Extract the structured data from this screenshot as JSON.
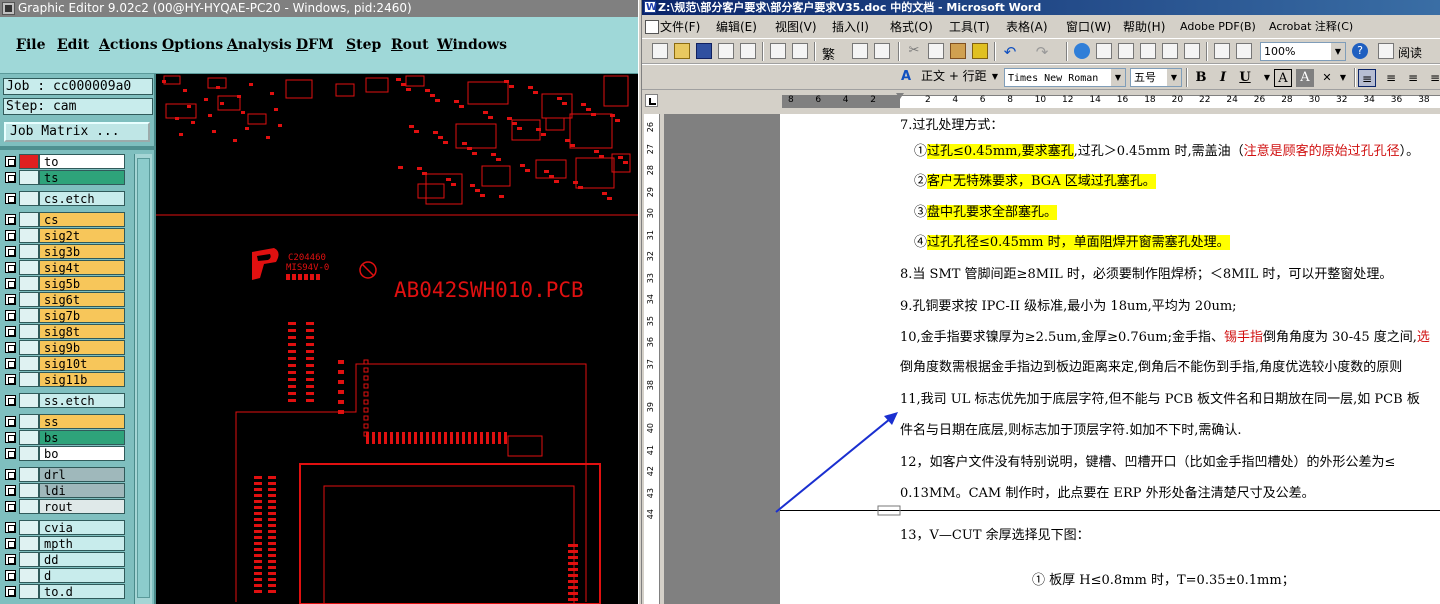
{
  "ge": {
    "title": "Graphic Editor 9.02c2 (00@HY-HYQAE-PC20 - Windows, pid:2460)",
    "menu": [
      "File",
      "Edit",
      "Actions",
      "Options",
      "Analysis",
      "DFM",
      "Step",
      "Rout",
      "Windows"
    ],
    "job": "Job : cc000009a0",
    "step": "Step: cam",
    "job_matrix": "Job Matrix ...",
    "layers": [
      {
        "name": "to",
        "color": "#ffffff",
        "gap": false
      },
      {
        "name": "ts",
        "color": "#2ea37a",
        "gap": false
      },
      {
        "name": "cs.etch",
        "color": "#c8ecec",
        "gap": true
      },
      {
        "name": "cs",
        "color": "#f7c65a",
        "gap": true
      },
      {
        "name": "sig2t",
        "color": "#f7c65a",
        "gap": false
      },
      {
        "name": "sig3b",
        "color": "#f7c65a",
        "gap": false
      },
      {
        "name": "sig4t",
        "color": "#f7c65a",
        "gap": false
      },
      {
        "name": "sig5b",
        "color": "#f7c65a",
        "gap": false
      },
      {
        "name": "sig6t",
        "color": "#f7c65a",
        "gap": false
      },
      {
        "name": "sig7b",
        "color": "#f7c65a",
        "gap": false
      },
      {
        "name": "sig8t",
        "color": "#f7c65a",
        "gap": false
      },
      {
        "name": "sig9b",
        "color": "#f7c65a",
        "gap": false
      },
      {
        "name": "sig10t",
        "color": "#f7c65a",
        "gap": false
      },
      {
        "name": "sig11b",
        "color": "#f7c65a",
        "gap": false
      },
      {
        "name": "ss.etch",
        "color": "#c8ecec",
        "gap": true
      },
      {
        "name": "ss",
        "color": "#f7c65a",
        "gap": true
      },
      {
        "name": "bs",
        "color": "#2ea37a",
        "gap": false
      },
      {
        "name": "bo",
        "color": "#ffffff",
        "gap": false
      },
      {
        "name": "drl",
        "color": "#9fb8bb",
        "gap": true
      },
      {
        "name": "ldi",
        "color": "#9fb8bb",
        "gap": false
      },
      {
        "name": "rout",
        "color": "#dfe9e9",
        "gap": false
      },
      {
        "name": "cvia",
        "color": "#c8ecec",
        "gap": true
      },
      {
        "name": "mpth",
        "color": "#c8ecec",
        "gap": false
      },
      {
        "name": "dd",
        "color": "#c8ecec",
        "gap": false
      },
      {
        "name": "d",
        "color": "#c8ecec",
        "gap": false
      },
      {
        "name": "to.d",
        "color": "#c8ecec",
        "gap": false
      }
    ],
    "pcb_label": "AB042SWH010.PCB",
    "pcb_small_1": "C204460",
    "pcb_small_2": "MIS94V-0",
    "pcb_color": "#e01010"
  },
  "wd": {
    "title": "Z:\\规范\\部分客户要求\\部分客户要求V35.doc 中的文档 - Microsoft Word",
    "menu": [
      "文件(F)",
      "编辑(E)",
      "视图(V)",
      "插入(I)",
      "格式(O)",
      "工具(T)",
      "表格(A)",
      "窗口(W)",
      "帮助(H)",
      "Adobe PDF(B)",
      "Acrobat 注释(C)"
    ],
    "zoom": "100%",
    "read_label": "阅读",
    "style": "正文 + 行距",
    "font": "Times New Roman",
    "size": "五号",
    "ruler_ticks": [
      "8",
      "6",
      "4",
      "2",
      "",
      "2",
      "4",
      "6",
      "8",
      "10",
      "12",
      "14",
      "16",
      "18",
      "20",
      "22",
      "24",
      "26",
      "28",
      "30",
      "32",
      "34",
      "36",
      "38"
    ],
    "vruler_ticks": [
      "26",
      "27",
      "28",
      "29",
      "30",
      "31",
      "32",
      "33",
      "34",
      "35",
      "36",
      "37",
      "38",
      "39",
      "40",
      "41",
      "42",
      "43",
      "44"
    ],
    "lines": {
      "l0": "7.过孔处理方式：",
      "l1a": "①",
      "l1b": "过孔≤0.45mm,要求塞孔",
      "l1c": ",过孔＞0.45mm 时,需盖油（",
      "l1d": "注意是顾客的原始过孔孔径",
      "l1e": "）。",
      "l2a": "②",
      "l2b": "客户无特殊要求，BGA 区域过孔塞孔。",
      "l3a": "③",
      "l3b": "盘中孔要求全部塞孔。",
      "l4a": "④",
      "l4b": "过孔孔径≤0.45mm 时，单面阻焊开窗需塞孔处理。",
      "l5": "8.当 SMT 管脚间距≥8MIL 时，必须要制作阻焊桥；＜8MIL 时，可以开整窗处理。",
      "l6": "9.孔铜要求按 IPC-II 级标准,最小为 18um,平均为 20um;",
      "l7a": "10,金手指要求镍厚为≥2.5um,金厚≥0.76um;金手指、",
      "l7b": "锡手指",
      "l7c": "倒角角度为 30-45 度之间,",
      "l7d": "选",
      "l8": "倒角度数需根据金手指边到板边距离来定,倒角后不能伤到手指,角度优选较小度数的原则",
      "l9": "11,我司 UL 标志优先加于底层字符,但不能与 PCB 板文件名和日期放在同一层,如 PCB 板",
      "l10": "件名与日期在底层,则标志加于顶层字符.如加不下时,需确认.",
      "l11": "12，如客户文件没有特别说明，键槽、凹槽开口（比如金手指凹槽处）的外形公差为≤",
      "l12": "0.13MM。CAM 制作时，此点要在 ERP 外形处备注清楚尺寸及公差。",
      "l13": "13，V—CUT 余厚选择见下图：",
      "l14a": "①",
      "l14b": "板厚 H≤0.8mm 时，T=0.35±0.1mm；"
    },
    "highlight_color": "#ffff00",
    "red_color": "#d01010"
  }
}
